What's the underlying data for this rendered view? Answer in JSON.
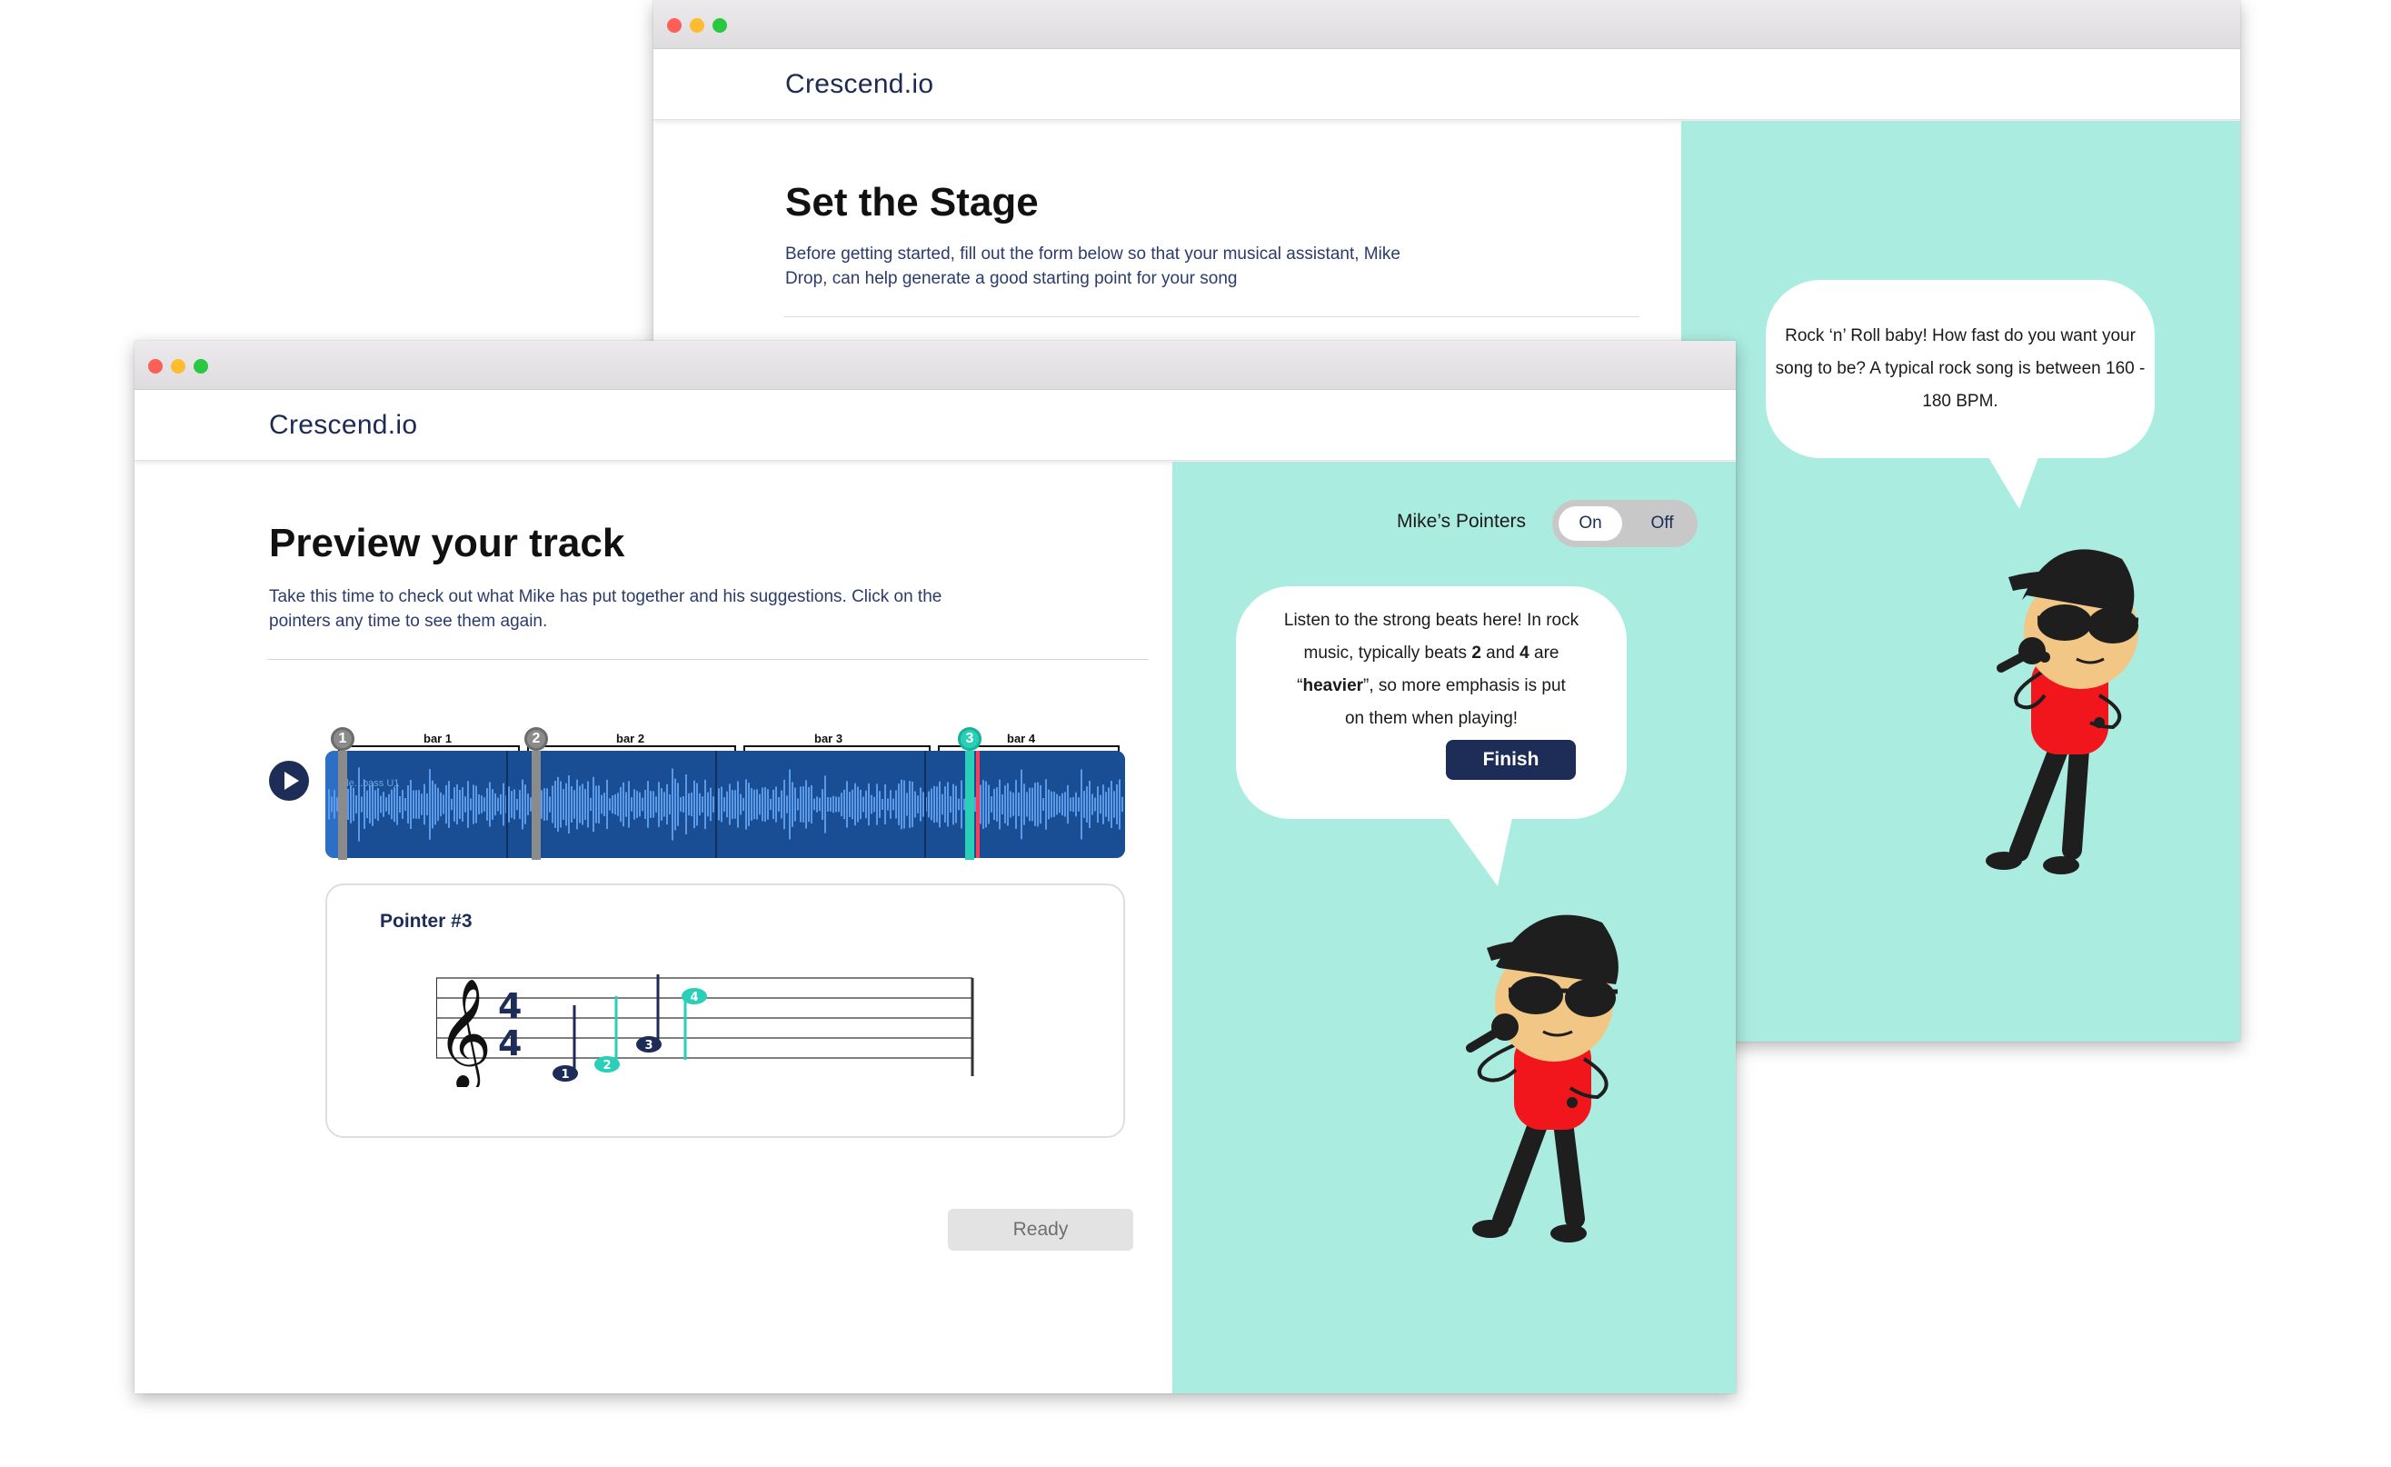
{
  "back_window": {
    "brand": "Crescend.io",
    "title": "Set the Stage",
    "description": "Before getting started, fill out the form below so that your musical assistant, Mike Drop, can help generate a good starting point for your song",
    "bubble_text": "Rock ‘n’ Roll baby! How fast do you want your song to be? A typical rock song is between 160 - 180 BPM."
  },
  "front_window": {
    "brand": "Crescend.io",
    "title": "Preview your track",
    "description": "Take this time to check out what Mike has put together and his suggestions. Click on the pointers any time to see them again.",
    "track": {
      "tag": "Ele...bass U1",
      "bars": [
        "bar 1",
        "bar 2",
        "bar 3",
        "bar 4"
      ],
      "pointers": [
        "1",
        "2",
        "3"
      ]
    },
    "pointer_card": {
      "title": "Pointer #3",
      "time_signature": [
        "4",
        "4"
      ],
      "note_numbers": [
        "1",
        "2",
        "3",
        "4"
      ]
    },
    "ready_label": "Ready",
    "toggle": {
      "label": "Mike’s Pointers",
      "on": "On",
      "off": "Off",
      "selected": "On"
    },
    "bubble": {
      "line1": "Listen to the strong beats here! In rock",
      "line2_pre": "music, typically beats ",
      "beat_a": "2",
      "line2_mid": " and ",
      "beat_b": "4",
      "line2_post": " are",
      "open_quote": "“",
      "heavier": "heavier",
      "line3_post": "”,  so more emphasis is put",
      "line4": "on them when playing!"
    },
    "finish_label": "Finish"
  },
  "colors": {
    "navy": "#1d2d57",
    "mint": "#abece1",
    "teal": "#29d0b7",
    "wave": "#1a4e94",
    "shirt": "#f0161b"
  }
}
